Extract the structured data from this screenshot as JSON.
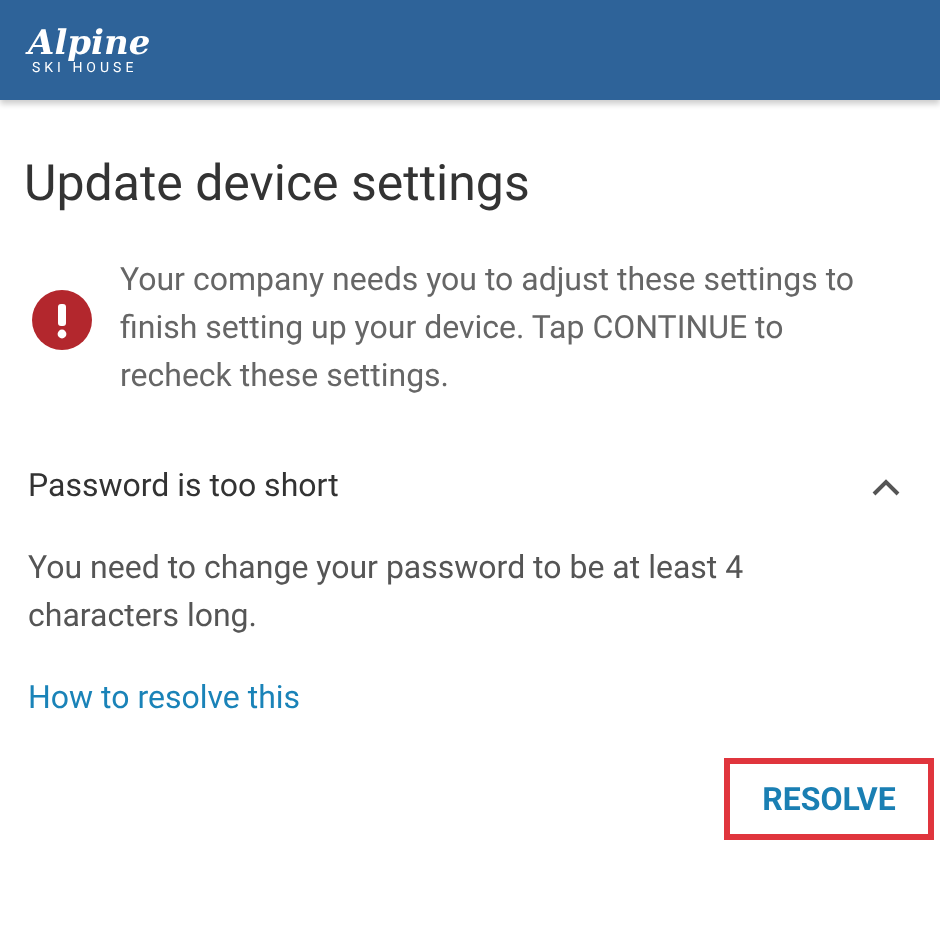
{
  "header": {
    "logo_title": "Alpine",
    "logo_subtitle": "SKI HOUSE"
  },
  "title": "Update device settings",
  "notice": {
    "kind": "error",
    "text": "Your company needs you to adjust these settings to finish setting up your device. Tap CONTINUE to recheck these settings."
  },
  "issue": {
    "title": "Password is too short",
    "expanded": true,
    "description": "You need to change your password to be at least 4 characters long.",
    "link": "How to resolve this"
  },
  "resolve_button": {
    "label": "RESOLVE",
    "highlighted": true
  }
}
